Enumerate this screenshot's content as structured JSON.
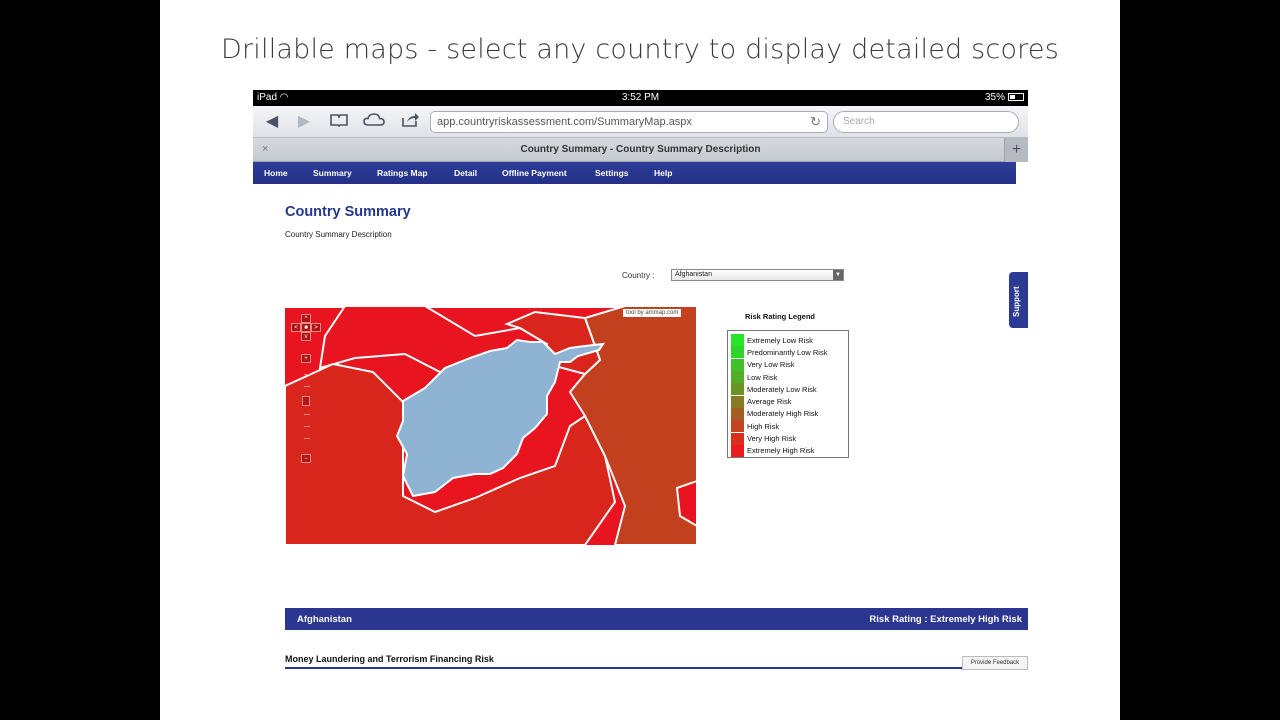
{
  "caption": "Drillable maps - select any country to display detailed scores",
  "statusbar": {
    "device": "iPad",
    "time": "3:52 PM",
    "battery": "35%"
  },
  "browser": {
    "url": "app.countryriskassessment.com/SummaryMap.aspx",
    "search_placeholder": "Search",
    "tab_title": "Country Summary -  Country Summary Description",
    "new_tab": "+",
    "close_tab": "×"
  },
  "nav": [
    "Home",
    "Summary",
    "Ratings Map",
    "Detail",
    "Offline Payment",
    "Settings",
    "Help"
  ],
  "page": {
    "title": "Country Summary",
    "subtitle": "Country Summary Description",
    "country_label": "Country :",
    "country_value": "Afghanistan",
    "support": "Support"
  },
  "map": {
    "credit": "tool by ammap.com",
    "selected_country": "Afghanistan",
    "selected_color": "#8fb3d3",
    "colors": {
      "extremely_high": "#e8141f",
      "very_high": "#d92a1c",
      "high": "#c9401e"
    }
  },
  "legend": {
    "title": "Risk Rating Legend",
    "items": [
      {
        "label": "Extremely Low Risk",
        "color": "#27e62a"
      },
      {
        "label": "Predominantly Low Risk",
        "color": "#2fd52a"
      },
      {
        "label": "Very Low Risk",
        "color": "#3fc22a"
      },
      {
        "label": "Low Risk",
        "color": "#52ac28"
      },
      {
        "label": "Moderately Low Risk",
        "color": "#6a9426"
      },
      {
        "label": "Average Risk",
        "color": "#857b24"
      },
      {
        "label": "Moderately High Risk",
        "color": "#a35f22"
      },
      {
        "label": "High Risk",
        "color": "#c24520"
      },
      {
        "label": "Very High Risk",
        "color": "#d9301e"
      },
      {
        "label": "Extremely High Risk",
        "color": "#ea1a1f"
      }
    ]
  },
  "summary": {
    "country": "Afghanistan",
    "rating": "Risk Rating :  Extremely High Risk"
  },
  "section": {
    "title": "Money Laundering and Terrorism Financing Risk",
    "feedback": "Provide Feedback"
  }
}
